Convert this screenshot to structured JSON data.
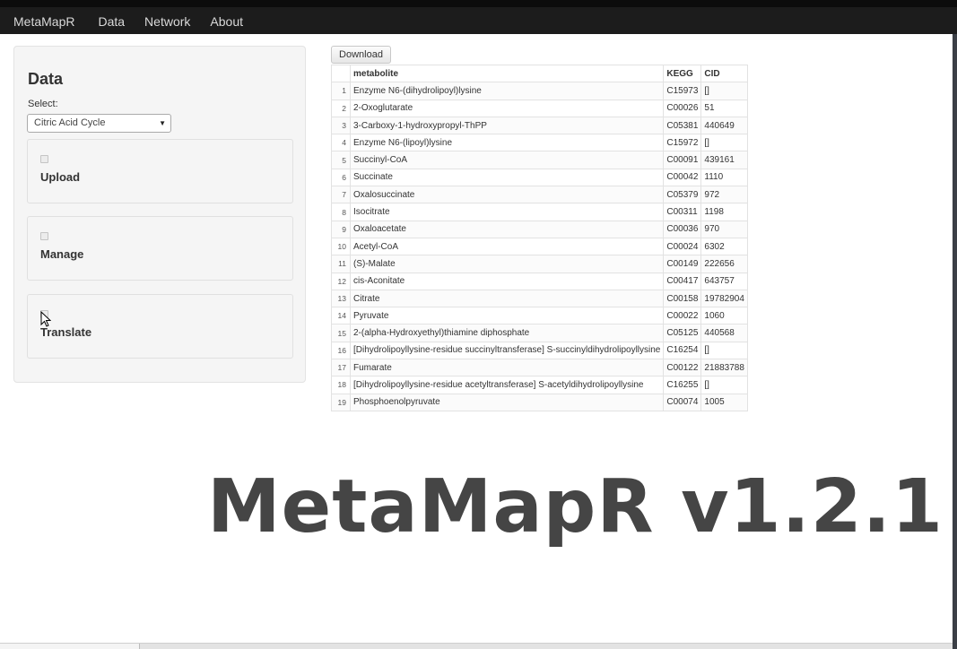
{
  "nav": {
    "brand": "MetaMapR",
    "items": [
      "Data",
      "Network",
      "About"
    ]
  },
  "sidebar": {
    "title": "Data",
    "select_label": "Select:",
    "select_value": "Citric Acid Cycle",
    "sections": [
      "Upload",
      "Manage",
      "Translate"
    ]
  },
  "main": {
    "download_label": "Download",
    "table": {
      "headers": [
        "",
        "metabolite",
        "KEGG",
        "CID"
      ],
      "rows": [
        [
          "1",
          "Enzyme N6-(dihydrolipoyl)lysine",
          "C15973",
          "[]"
        ],
        [
          "2",
          "2-Oxoglutarate",
          "C00026",
          "51"
        ],
        [
          "3",
          "3-Carboxy-1-hydroxypropyl-ThPP",
          "C05381",
          "440649"
        ],
        [
          "4",
          "Enzyme N6-(lipoyl)lysine",
          "C15972",
          "[]"
        ],
        [
          "5",
          "Succinyl-CoA",
          "C00091",
          "439161"
        ],
        [
          "6",
          "Succinate",
          "C00042",
          "1110"
        ],
        [
          "7",
          "Oxalosuccinate",
          "C05379",
          "972"
        ],
        [
          "8",
          "Isocitrate",
          "C00311",
          "1198"
        ],
        [
          "9",
          "Oxaloacetate",
          "C00036",
          "970"
        ],
        [
          "10",
          "Acetyl-CoA",
          "C00024",
          "6302"
        ],
        [
          "11",
          "(S)-Malate",
          "C00149",
          "222656"
        ],
        [
          "12",
          "cis-Aconitate",
          "C00417",
          "643757"
        ],
        [
          "13",
          "Citrate",
          "C00158",
          "19782904"
        ],
        [
          "14",
          "Pyruvate",
          "C00022",
          "1060"
        ],
        [
          "15",
          "2-(alpha-Hydroxyethyl)thiamine diphosphate",
          "C05125",
          "440568"
        ],
        [
          "16",
          "[Dihydrolipoyllysine-residue succinyltransferase] S-succinyldihydrolipoyllysine",
          "C16254",
          "[]"
        ],
        [
          "17",
          "Fumarate",
          "C00122",
          "21883788"
        ],
        [
          "18",
          "[Dihydrolipoyllysine-residue acetyltransferase] S-acetyldihydrolipoyllysine",
          "C16255",
          "[]"
        ],
        [
          "19",
          "Phosphoenolpyruvate",
          "C00074",
          "1005"
        ]
      ]
    }
  },
  "overlay": {
    "title": "MetaMapR v1.2.1"
  },
  "icons": {
    "cursor": "mouse-pointer-icon",
    "select_chevron": "chevron-down-icon"
  }
}
